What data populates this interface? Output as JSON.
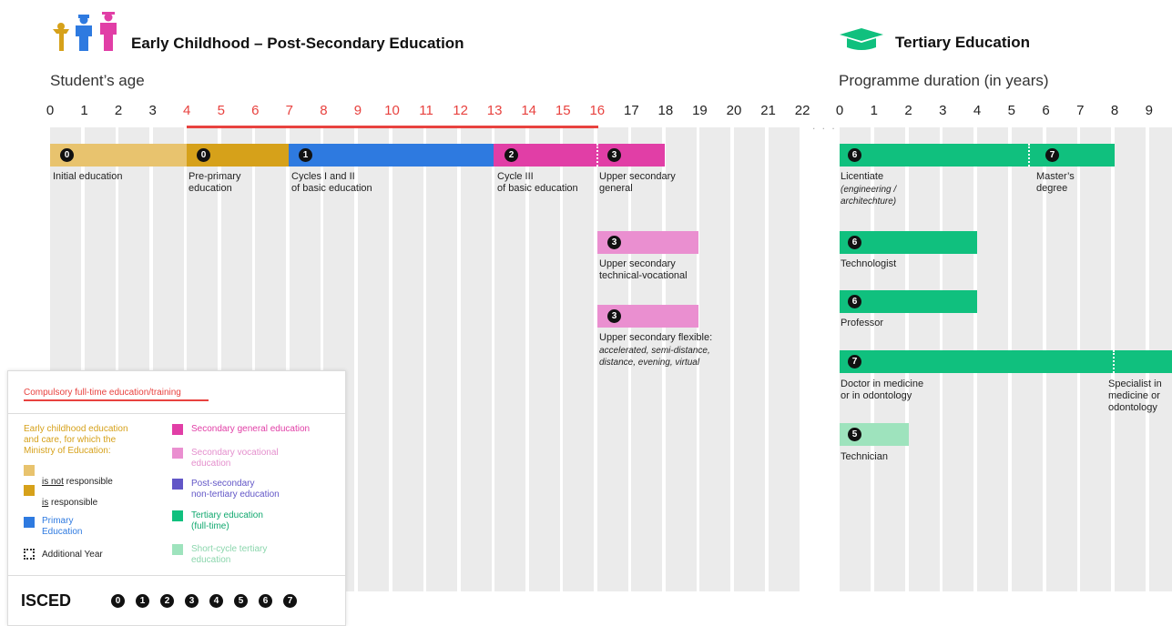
{
  "header": {
    "left_title": "Early Childhood – Post-Secondary Education",
    "right_title": "Tertiary Education",
    "left_subtitle": "Student’s age",
    "right_subtitle": "Programme duration (in years)"
  },
  "colors": {
    "initial": "#e8c36e",
    "preprimary": "#d6a11a",
    "primary": "#2e7ae0",
    "secondary_general": "#e13ea6",
    "secondary_vocational": "#ea8fd0",
    "tertiary": "#10c07e",
    "short_cycle": "#9ee3bd",
    "post_secondary": "#6256c7",
    "compulsory": "#e8423f"
  },
  "age_axis": [
    "0",
    "1",
    "2",
    "3",
    "4",
    "5",
    "6",
    "7",
    "8",
    "9",
    "10",
    "11",
    "12",
    "13",
    "14",
    "15",
    "16",
    "17",
    "18",
    "19",
    "20",
    "21",
    "22"
  ],
  "duration_axis": [
    "0",
    "1",
    "2",
    "3",
    "4",
    "5",
    "6",
    "7",
    "8",
    "9"
  ],
  "programs_left": [
    {
      "badge": "0",
      "label": "Initial education"
    },
    {
      "badge": "0",
      "label": "Pre-primary\neducation"
    },
    {
      "badge": "1",
      "label": "Cycles I and II\nof basic education"
    },
    {
      "badge": "2",
      "label": "Cycle III\nof basic education"
    },
    {
      "badge": "3",
      "label": "Upper secondary\ngeneral"
    },
    {
      "badge": "3",
      "label": "Upper secondary\ntechnical-vocational"
    },
    {
      "badge": "3",
      "label": "Upper secondary flexible:",
      "note": "accelerated, semi-distance,\ndistance, evening, virtual"
    }
  ],
  "programs_right": [
    {
      "badge": "6",
      "label": "Licentiate",
      "note": "(engineering /\narchitechture)"
    },
    {
      "badge": "7",
      "label": "Master’s\ndegree"
    },
    {
      "badge": "6",
      "label": "Technologist"
    },
    {
      "badge": "6",
      "label": "Professor"
    },
    {
      "badge": "7",
      "label": "Doctor in medicine\nor in odontology"
    },
    {
      "badge": "7",
      "label": "Specialist in\nmedicine or\nodontology"
    },
    {
      "badge": "5",
      "label": "Technician"
    }
  ],
  "legend": {
    "compulsory": "Compulsory full-time education/training",
    "ecec_heading": "Early childhood education\nand care, for which the\nMinistry of Education:",
    "not_responsible_under": "is not",
    "not_responsible_rest": " responsible",
    "responsible_under": "is",
    "responsible_rest": " responsible",
    "primary": "Primary\nEducation",
    "additional_year": "Additional Year",
    "secondary_general": "Secondary general education",
    "secondary_vocational": "Secondary vocational\neducation",
    "post_secondary": "Post-secondary\nnon-tertiary education",
    "tertiary": "Tertiary education\n(full-time)",
    "short_cycle": "Short-cycle tertiary\neducation",
    "isced_label": "ISCED",
    "isced_levels": [
      "0",
      "1",
      "2",
      "3",
      "4",
      "5",
      "6",
      "7"
    ]
  }
}
